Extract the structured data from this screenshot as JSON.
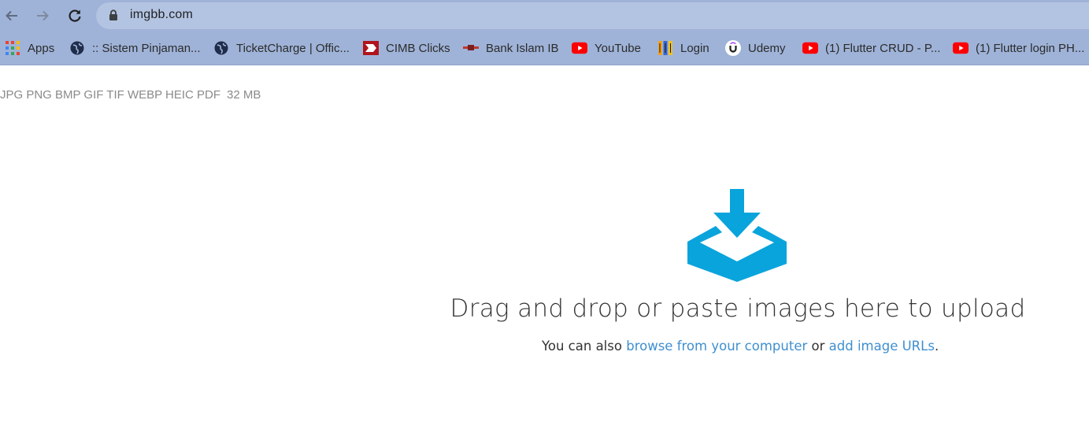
{
  "browser": {
    "url": "imgbb.com",
    "bookmarks": [
      {
        "label": "Apps",
        "icon": "apps-grid-icon"
      },
      {
        "label": ":: Sistem Pinjaman...",
        "icon": "globe-icon"
      },
      {
        "label": "TicketCharge | Offic...",
        "icon": "globe-icon"
      },
      {
        "label": "CIMB Clicks",
        "icon": "cimb-icon"
      },
      {
        "label": "Bank Islam IB",
        "icon": "bank-islam-icon"
      },
      {
        "label": "YouTube",
        "icon": "youtube-icon"
      },
      {
        "label": "Login",
        "icon": "login-icon"
      },
      {
        "label": "Udemy",
        "icon": "udemy-icon"
      },
      {
        "label": "(1) Flutter CRUD - P...",
        "icon": "youtube-icon"
      },
      {
        "label": "(1) Flutter login PH...",
        "icon": "youtube-icon"
      }
    ]
  },
  "page": {
    "formats": "JPG PNG BMP GIF TIF WEBP HEIC PDF",
    "max_size": "32 MB",
    "headline": "Drag and drop or paste images here to upload",
    "sub_prefix": "You can also",
    "browse_link": "browse from your computer",
    "sub_or": "or",
    "urls_link": "add image URLs",
    "sub_suffix": "."
  },
  "colors": {
    "chrome": "#9fb3d8",
    "omnibox": "#b3c4e2",
    "accent": "#0aa4dc",
    "link": "#3f8fcf",
    "youtube": "#ff0000"
  }
}
